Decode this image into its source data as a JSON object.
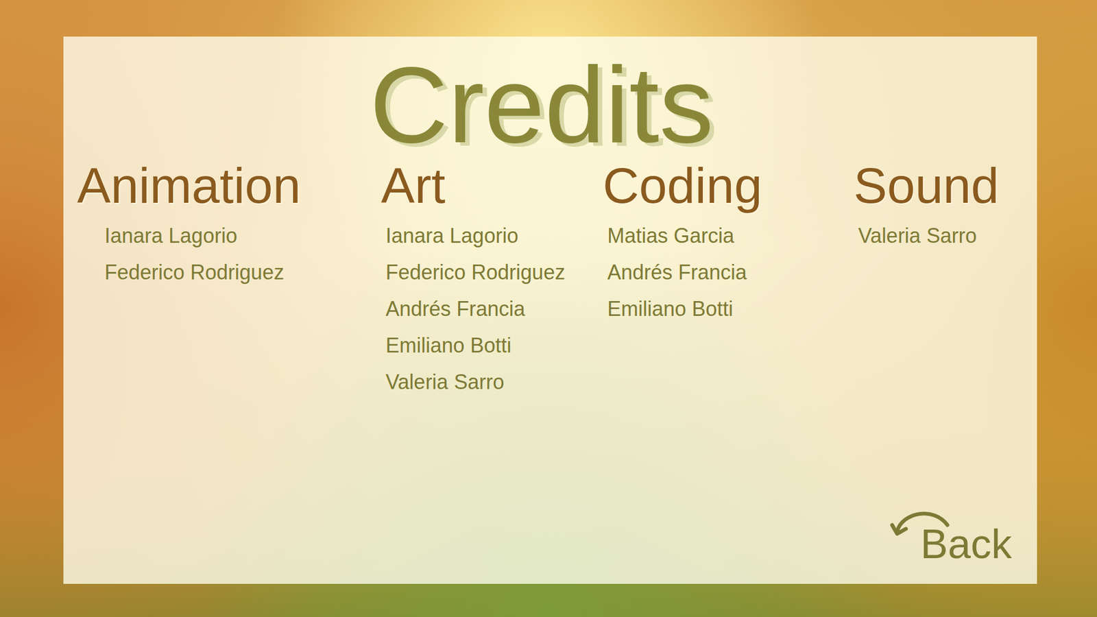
{
  "title": "Credits",
  "sections": [
    {
      "heading": "Animation",
      "names": [
        "Ianara Lagorio",
        "Federico Rodriguez"
      ]
    },
    {
      "heading": "Art",
      "names": [
        "Ianara Lagorio",
        "Federico Rodriguez",
        "Andrés Francia",
        "Emiliano Botti",
        "Valeria Sarro"
      ]
    },
    {
      "heading": "Coding",
      "names": [
        "Matias Garcia",
        "Andrés Francia",
        "Emiliano Botti"
      ]
    },
    {
      "heading": "Sound",
      "names": [
        "Valeria Sarro"
      ]
    }
  ],
  "back": {
    "label": "Back"
  }
}
